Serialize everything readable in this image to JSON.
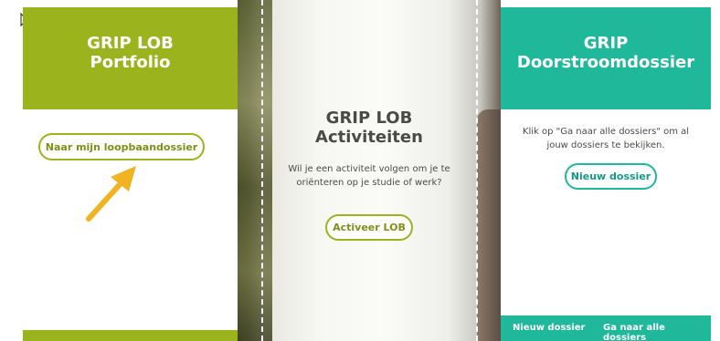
{
  "portfolio_panel": {
    "title_line1": "GRIP LOB",
    "title_line2": "Portfolio",
    "button_label": "Naar mijn loopbaandossier",
    "accent_color": "#9bb31c"
  },
  "activities_panel": {
    "title_line1": "GRIP LOB",
    "title_line2": "Activiteiten",
    "description": "Wil je een activiteit volgen om je te oriënteren op je studie of werk?",
    "button_label": "Activeer LOB"
  },
  "dossier_panel": {
    "title_line1": "GRIP",
    "title_line2": "Doorstroomdossier",
    "description": "Klik op \"Ga naar alle dossiers\" om al jouw dossiers te bekijken.",
    "button_label": "Nieuw dossier",
    "footer_links": [
      "Nieuw dossier",
      "Ga naar alle dossiers"
    ],
    "accent_color": "#1fb89b"
  },
  "annotation": {
    "icon": "arrow-icon",
    "color": "#f2b322"
  }
}
